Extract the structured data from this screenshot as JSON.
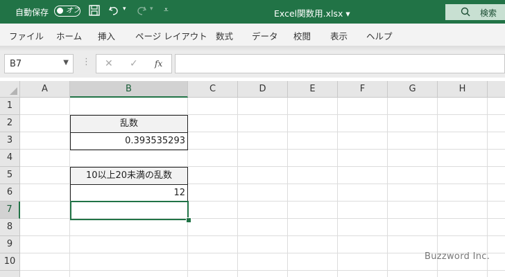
{
  "titlebar": {
    "autosave_label": "自動保存",
    "autosave_toggle": "オフ",
    "document_title": "Excel関数用.xlsx",
    "title_caret": "▾",
    "search_label": "検索",
    "accent_color": "#217346"
  },
  "ribbon": {
    "tabs": [
      "ファイル",
      "ホーム",
      "挿入",
      "ページ レイアウト",
      "数式",
      "データ",
      "校閲",
      "表示",
      "ヘルプ"
    ]
  },
  "formula_bar": {
    "name_box": "B7",
    "cancel_glyph": "✕",
    "enter_glyph": "✓",
    "fx_label": "fx",
    "formula": ""
  },
  "sheet": {
    "columns": [
      "A",
      "B",
      "C",
      "D",
      "E",
      "F",
      "G",
      "H"
    ],
    "rows": [
      "1",
      "2",
      "3",
      "4",
      "5",
      "6",
      "7",
      "8",
      "9",
      "10"
    ],
    "selected_column": "B",
    "selected_row": "7",
    "cells": {
      "B2": "乱数",
      "B3": "0.393535293",
      "B5": "10以上20未満の乱数",
      "B6": "12"
    }
  },
  "watermark": "Buzzword Inc."
}
